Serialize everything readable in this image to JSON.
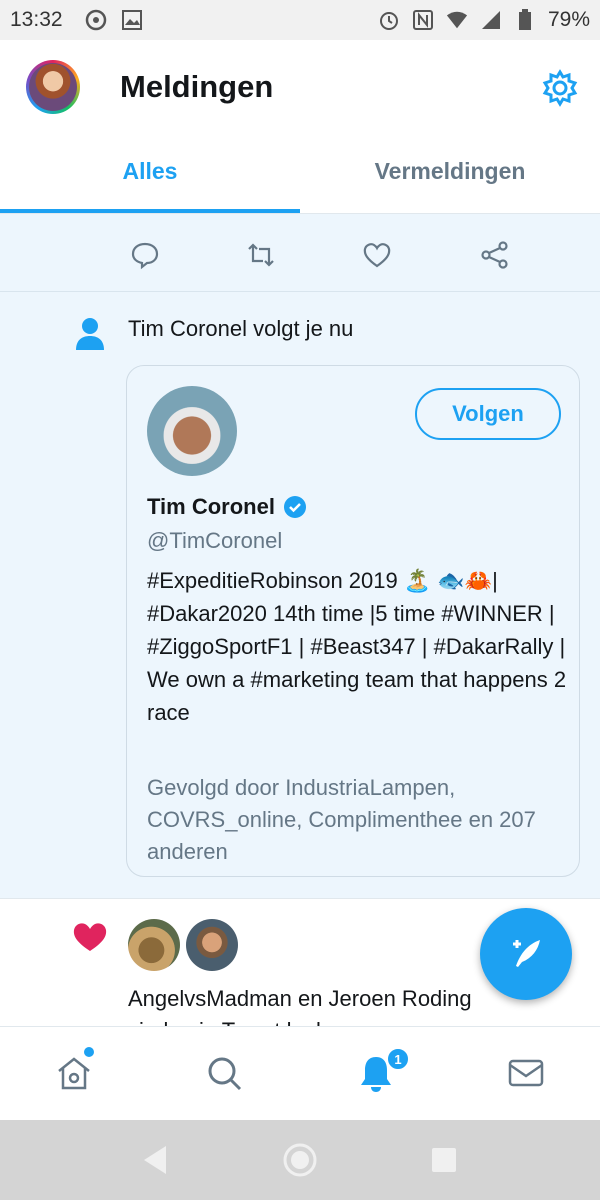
{
  "status_bar": {
    "time": "13:32",
    "battery": "79%"
  },
  "header": {
    "title": "Meldingen"
  },
  "tabs": [
    {
      "label": "Alles",
      "active": true
    },
    {
      "label": "Vermeldingen",
      "active": false
    }
  ],
  "follow_notification": {
    "text": "Tim Coronel volgt je nu",
    "card": {
      "follow_button": "Volgen",
      "name": "Tim Coronel",
      "handle": "@TimCoronel",
      "bio": "#ExpeditieRobinson 2019 🏝️ 🐟🦀| #Dakar2020 14th time |5 time #WINNER | #ZiggoSportF1 | #Beast347 | #DakarRally | We own a #marketing team that happens 2 race",
      "followed_by": "Gevolgd door IndustriaLampen, COVRS_online, Complimenthee en 207 anderen"
    }
  },
  "like_notification": {
    "text": "AngelvsMadman en Jeroen Roding vinden je Tweet leuk"
  },
  "bottom_nav": {
    "notifications_badge": "1"
  },
  "colors": {
    "accent": "#1da1f2",
    "like": "#e0245e",
    "highlight_bg": "#edf6fd"
  }
}
